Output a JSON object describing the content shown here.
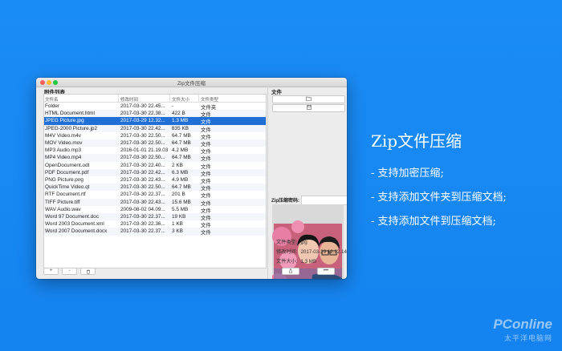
{
  "window": {
    "title": "Zip文件压缩",
    "left_label": "附件列表",
    "columns": [
      "文件名",
      "修改时间",
      "文件大小",
      "文件类型"
    ],
    "rows": [
      {
        "name": "Folder",
        "time": "2017-03-30 22.45...",
        "size": "-",
        "type": "文件夹"
      },
      {
        "name": "HTML Document.html",
        "time": "2017-03-30 22.38...",
        "size": "422 B",
        "type": "文件"
      },
      {
        "name": "JPEG Picture.jpg",
        "time": "2017-03-29 12.32...",
        "size": "1.3 MB",
        "type": "文件",
        "selected": true
      },
      {
        "name": "JPEG-2000 Picture.jp2",
        "time": "2017-03-30 22.42...",
        "size": "835 KB",
        "type": "文件"
      },
      {
        "name": "M4V Video.m4v",
        "time": "2017-03-30 22.50...",
        "size": "64.7 MB",
        "type": "文件"
      },
      {
        "name": "MOV Video.mov",
        "time": "2017-03-30 22.50...",
        "size": "64.7 MB",
        "type": "文件"
      },
      {
        "name": "MP3 Audio.mp3",
        "time": "2016-01-01 21.19.03",
        "size": "4.2 MB",
        "type": "文件"
      },
      {
        "name": "MP4 Video.mp4",
        "time": "2017-03-30 22.50...",
        "size": "64.7 MB",
        "type": "文件"
      },
      {
        "name": "OpenDocument.odt",
        "time": "2017-03-30 22.40...",
        "size": "2 KB",
        "type": "文件"
      },
      {
        "name": "PDF Document.pdf",
        "time": "2017-03-30 22.42...",
        "size": "6.3 MB",
        "type": "文件"
      },
      {
        "name": "PNG Picture.png",
        "time": "2017-03-30 22.43...",
        "size": "4.9 MB",
        "type": "文件"
      },
      {
        "name": "QuickTime Video.qt",
        "time": "2017-03-30 22.50...",
        "size": "64.7 MB",
        "type": "文件"
      },
      {
        "name": "RTF Document.rtf",
        "time": "2017-03-30 22.37...",
        "size": "201 B",
        "type": "文件"
      },
      {
        "name": "TIFF Picture.tiff",
        "time": "2017-03-30 22.43...",
        "size": "15.6 MB",
        "type": "文件"
      },
      {
        "name": "WAV Audio.wav",
        "time": "2009-08-02 04.09...",
        "size": "5.5 MB",
        "type": "文件"
      },
      {
        "name": "Word 97 Document.doc",
        "time": "2017-03-30 22.37...",
        "size": "19 KB",
        "type": "文件"
      },
      {
        "name": "Word 2003 Document.xml",
        "time": "2017-03-30 22.36...",
        "size": "1 KB",
        "type": "文件"
      },
      {
        "name": "Word 2007 Document.docx",
        "time": "2017-03-30 22.37...",
        "size": "3 KB",
        "type": "文件"
      }
    ],
    "buttons": {
      "add": "+",
      "remove": "-"
    },
    "right_label": "文件",
    "password_label": "Zip压缩密码:",
    "password_value": "",
    "info": [
      {
        "label": "文件类型:",
        "value": "jpg"
      },
      {
        "label": "修改时间:",
        "value": "2017-03-29 12.32.14"
      },
      {
        "label": "文件大小:",
        "value": "1.3 MB"
      }
    ],
    "more_button": "•••"
  },
  "promo": {
    "title": "Zip文件压缩",
    "lines": [
      "- 支持加密压缩;",
      "- 支持添加文件夹到压缩文档;",
      "- 支持添加文件到压缩文档;"
    ]
  },
  "watermark": {
    "main": "PConline",
    "sub": "太平洋电脑网"
  }
}
